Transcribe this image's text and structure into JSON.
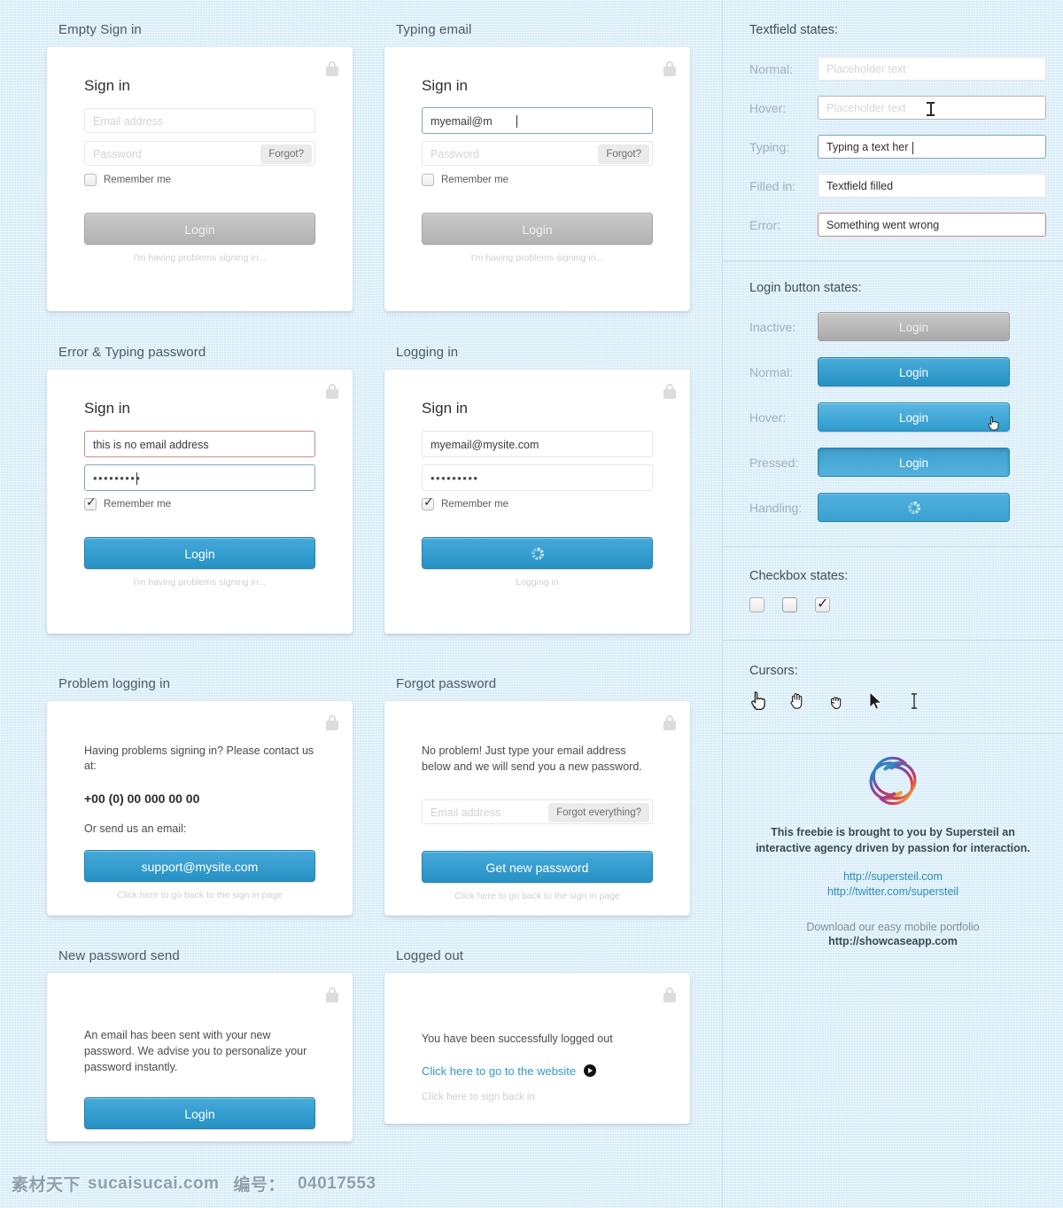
{
  "left_panels": [
    {
      "title": "Empty Sign in",
      "type": "signin",
      "heading": "Sign in",
      "email_placeholder": "Email address",
      "email_value": "",
      "email_state": "empty",
      "password_placeholder": "Password",
      "password_value": "",
      "password_state": "empty",
      "forgot_label": "Forgot?",
      "remember_label": "Remember me",
      "remember_checked": false,
      "button_label": "Login",
      "button_state": "inactive",
      "subnote": "I'm having problems signing in..."
    },
    {
      "title": "Typing email",
      "type": "signin",
      "heading": "Sign in",
      "email_placeholder": "Email address",
      "email_value": "myemail@m",
      "email_state": "typing",
      "password_placeholder": "Password",
      "password_value": "",
      "password_state": "empty",
      "forgot_label": "Forgot?",
      "remember_label": "Remember me",
      "remember_checked": false,
      "button_label": "Login",
      "button_state": "inactive",
      "subnote": "I'm having problems signing in..."
    },
    {
      "title": "Error & Typing password",
      "type": "signin",
      "heading": "Sign in",
      "email_placeholder": "Email address",
      "email_value": "this is no email address",
      "email_state": "error",
      "password_placeholder": "Password",
      "password_value": "•••••••••",
      "password_state": "typing",
      "forgot_label": "",
      "remember_label": "Remember me",
      "remember_checked": true,
      "button_label": "Login",
      "button_state": "normal",
      "subnote": "I'm having problems signing in..."
    },
    {
      "title": "Logging in",
      "type": "signin",
      "heading": "Sign in",
      "email_placeholder": "Email address",
      "email_value": "myemail@mysite.com",
      "email_state": "filled",
      "password_placeholder": "Password",
      "password_value": "•••••••••",
      "password_state": "filled",
      "forgot_label": "",
      "remember_label": "Remember me",
      "remember_checked": true,
      "button_label": "",
      "button_state": "handling",
      "subnote": "Logging in"
    },
    {
      "title": "Problem logging in",
      "type": "problem",
      "message": "Having problems signing in? Please contact us at:",
      "phone": "+00 (0) 00 000 00 00",
      "message2": "Or send us an email:",
      "button_label": "support@mysite.com",
      "subnote": "Click here to go back to the sign in page"
    },
    {
      "title": "Forgot password",
      "type": "forgot",
      "message": "No problem! Just type your email address below and we will send you a new password.",
      "email_placeholder": "Email address",
      "forgot_everything_label": "Forgot everything?",
      "button_label": "Get new password",
      "subnote": "Click here to go back to the sign in page"
    },
    {
      "title": "New password send",
      "type": "sent",
      "message": "An email has been sent with your new password. We advise you to personalize your password instantly.",
      "button_label": "Login"
    },
    {
      "title": "Logged out",
      "type": "loggedout",
      "message": "You have been successfully logged out",
      "link_label": "Click here to go to the website",
      "subnote": "Click here to sign back in"
    }
  ],
  "textfield_states": {
    "title": "Textfield states:",
    "rows": [
      {
        "label": "Normal:",
        "value": "",
        "placeholder": "Placeholder text",
        "state": "normal"
      },
      {
        "label": "Hover:",
        "value": "",
        "placeholder": "Placeholder text",
        "state": "hover"
      },
      {
        "label": "Typing:",
        "value": "Typing a text her",
        "placeholder": "",
        "state": "typing"
      },
      {
        "label": "Filled in:",
        "value": "Textfield filled",
        "placeholder": "",
        "state": "filled"
      },
      {
        "label": "Error:",
        "value": "Something went wrong",
        "placeholder": "",
        "state": "error"
      }
    ]
  },
  "login_button_states": {
    "title": "Login button states:",
    "rows": [
      {
        "label": "Inactive:",
        "button_label": "Login",
        "state": "inactive"
      },
      {
        "label": "Normal:",
        "button_label": "Login",
        "state": "normal"
      },
      {
        "label": "Hover:",
        "button_label": "Login",
        "state": "hover"
      },
      {
        "label": "Pressed:",
        "button_label": "Login",
        "state": "pressed"
      },
      {
        "label": "Handling:",
        "button_label": "",
        "state": "handling"
      }
    ]
  },
  "checkbox_states": {
    "title": "Checkbox states:",
    "items": [
      {
        "state": "normal",
        "checked": false
      },
      {
        "state": "hover",
        "checked": false
      },
      {
        "state": "checked",
        "checked": true
      }
    ]
  },
  "cursors": {
    "title": "Cursors:",
    "items": [
      {
        "name": "pointing-hand-click-cursor-icon"
      },
      {
        "name": "open-hand-cursor-icon"
      },
      {
        "name": "grab-hand-cursor-icon"
      },
      {
        "name": "arrow-pointer-cursor-icon"
      },
      {
        "name": "text-ibeam-cursor-icon"
      }
    ]
  },
  "footer": {
    "logo_name": "supersteil-logo",
    "credit": "This freebie is brought to you by Supersteil an interactive agency driven by passion for interaction.",
    "links": [
      "http://supersteil.com",
      "http://twitter.com/supersteil"
    ],
    "download_line1": "Download our easy mobile portfolio",
    "download_line2": "http://showcaseapp.com"
  },
  "watermark": {
    "site_cn": "素材天下",
    "site_domain": "sucaisucai.com",
    "id_label": "编号：",
    "id_value": "04017553"
  },
  "colors": {
    "background": "#d9edf8",
    "accent_blue": "#2791c4",
    "link_blue": "#2b8cbe",
    "error_red": "#c48681",
    "inactive_grey": "#b2b2b2"
  }
}
